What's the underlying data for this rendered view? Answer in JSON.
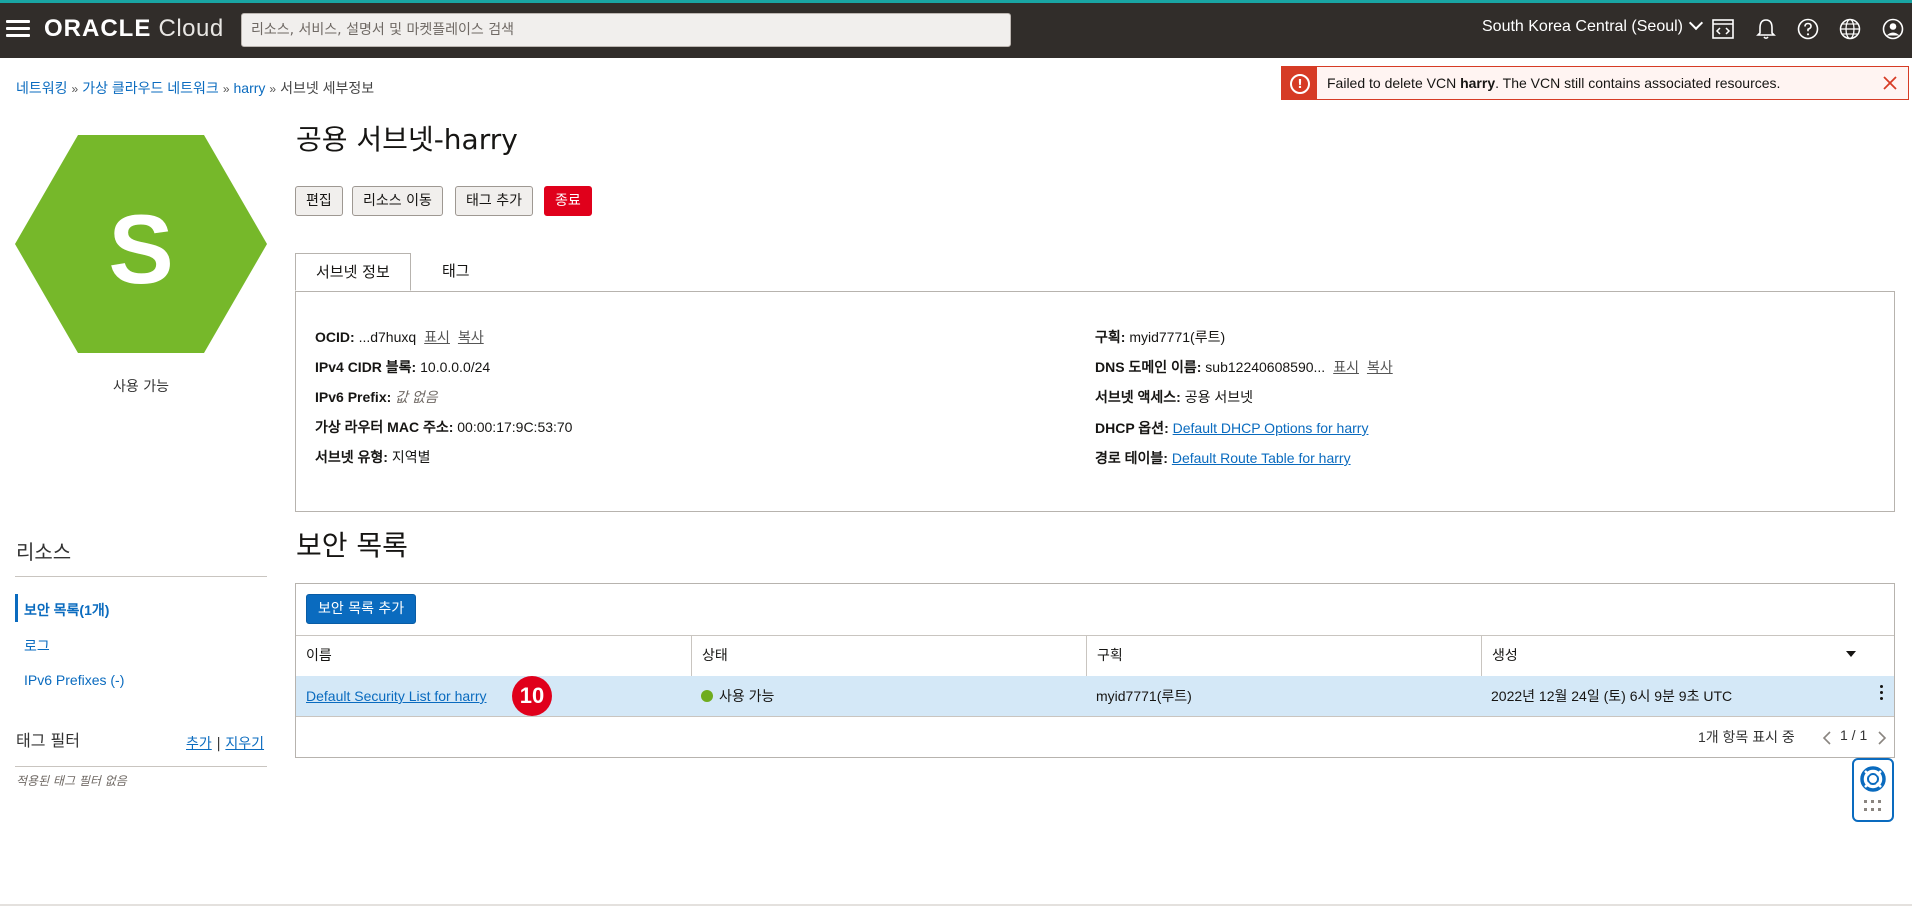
{
  "topbar": {
    "brand_word": "ORACLE",
    "brand_sub": "Cloud",
    "search_placeholder": "리소스, 서비스, 설명서 및 마켓플레이스 검색",
    "region": "South Korea Central (Seoul)",
    "icons": [
      "menu-icon",
      "code-editor-icon",
      "bell-icon",
      "help-icon",
      "globe-icon",
      "user-icon"
    ]
  },
  "toast": {
    "prefix": "Failed to delete VCN ",
    "bold": "harry",
    "suffix": ". The VCN still contains associated resources.",
    "color": "#d63b25"
  },
  "breadcrumb": {
    "items": [
      "네트워킹",
      "가상 클라우드 네트워크",
      "harry"
    ],
    "current": "서브넷 세부정보"
  },
  "resource": {
    "letter": "S",
    "status": "사용 가능",
    "hex_color": "#76b82a"
  },
  "page": {
    "title": "공용 서브넷-harry"
  },
  "actions": {
    "edit": "편집",
    "move": "리소스 이동",
    "add_tag": "태그 추가",
    "terminate": "종료"
  },
  "tabs": {
    "info": "서브넷 정보",
    "tags": "태그"
  },
  "info": {
    "ocid_label": "OCID:",
    "ocid_value": "...d7huxq",
    "show": "표시",
    "copy": "복사",
    "ipv4_label": "IPv4 CIDR 블록:",
    "ipv4_value": "10.0.0.0/24",
    "ipv6_label": "IPv6 Prefix:",
    "ipv6_value": "값 없음",
    "mac_label": "가상 라우터 MAC 주소:",
    "mac_value": "00:00:17:9C:53:70",
    "type_label": "서브넷 유형:",
    "type_value": "지역별",
    "compartment_label": "구획:",
    "compartment_value": "myid7771(루트)",
    "dns_label": "DNS 도메인 이름:",
    "dns_value": "sub12240608590...",
    "access_label": "서브넷 액세스:",
    "access_value": "공용 서브넷",
    "dhcp_label": "DHCP 옵션:",
    "dhcp_value": "Default DHCP Options for harry",
    "route_label": "경로 테이블:",
    "route_value": "Default Route Table for harry"
  },
  "sidebar": {
    "resources_title": "리소스",
    "items": [
      "보안 목록(1개)",
      "로그",
      "IPv6 Prefixes (-)"
    ],
    "tag_filter_title": "태그 필터",
    "tag_add": "추가",
    "tag_sep": "|",
    "tag_clear": "지우기",
    "no_tags": "적용된 태그 필터 없음"
  },
  "security_lists": {
    "title": "보안 목록",
    "add_button": "보안 목록 추가",
    "columns": [
      "이름",
      "상태",
      "구획",
      "생성"
    ],
    "rows": [
      {
        "name": "Default Security List for harry",
        "status": "사용 가능",
        "compartment": "myid7771(루트)",
        "created": "2022년 12월 24일 (토) 6시 9분 9초 UTC"
      }
    ],
    "annotation": "10",
    "footer_count": "1개 항목 표시 중",
    "page": "1 / 1"
  }
}
